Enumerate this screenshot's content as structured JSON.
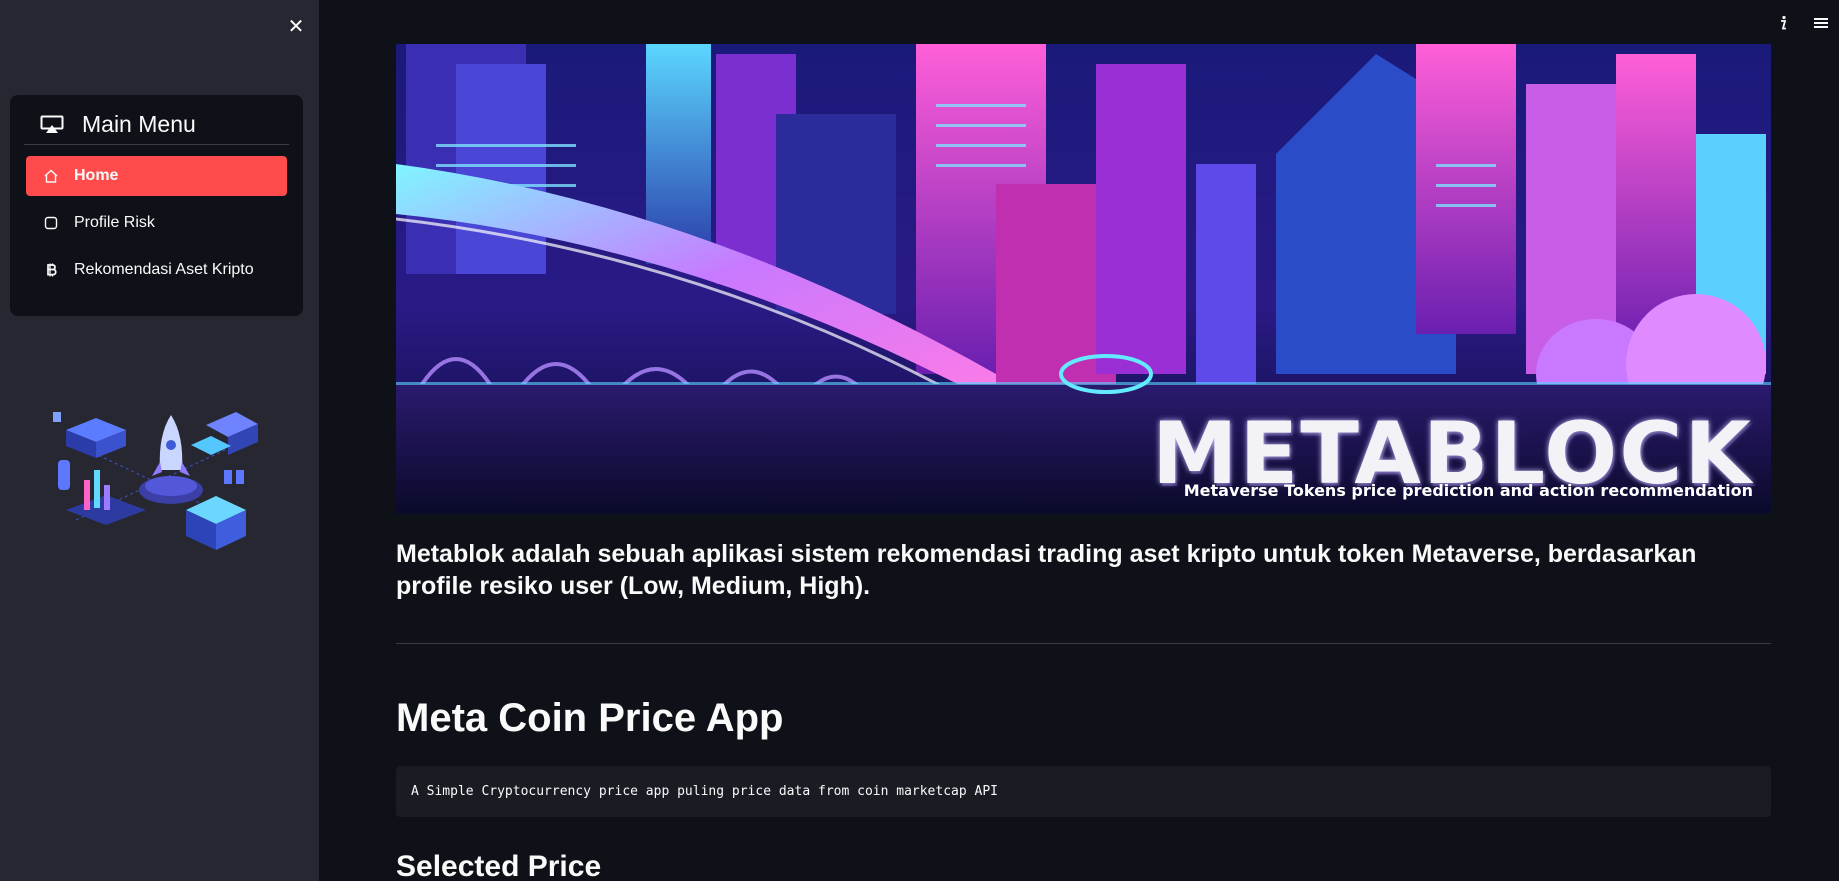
{
  "sidebar": {
    "close_icon": "close-icon",
    "menu": {
      "title": "Main Menu",
      "title_icon": "cast-icon",
      "items": [
        {
          "label": "Home",
          "icon": "house-icon",
          "active": true
        },
        {
          "label": "Profile Risk",
          "icon": "square-icon",
          "active": false
        },
        {
          "label": "Rekomendasi Aset Kripto",
          "icon": "bitcoin-icon",
          "active": false
        }
      ],
      "active_color": "#ff4b4b"
    },
    "illustration": "isometric-crypto-illustration"
  },
  "toolbar": {
    "info_icon": "info-icon",
    "menu_icon": "hamburger-icon"
  },
  "main": {
    "banner": {
      "title": "METABLOCK",
      "subtitle": "Metaverse Tokens price prediction and action recommendation"
    },
    "intro": "Metablok adalah sebuah aplikasi sistem rekomendasi trading aset kripto untuk token Metaverse, berdasarkan profile resiko user (Low, Medium, High).",
    "app_title": "Meta Coin Price App",
    "app_description": "A Simple Cryptocurrency price app puling price data from coin marketcap API",
    "section_title": "Selected Price"
  },
  "colors": {
    "background": "#0e1117",
    "sidebar": "#262730",
    "accent": "#ff4b4b",
    "code_background": "#1a1c24"
  }
}
